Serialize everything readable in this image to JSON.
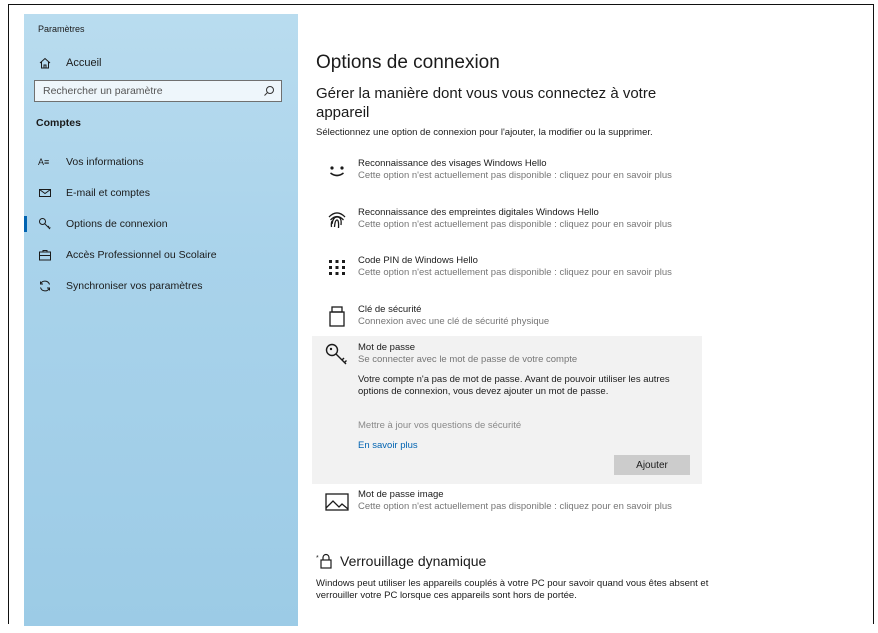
{
  "sidebar": {
    "app_title": "Paramètres",
    "home_label": "Accueil",
    "search_placeholder": "Rechercher un paramètre",
    "section_title": "Comptes",
    "items": [
      {
        "label": "Vos informations",
        "icon": "person-card-icon"
      },
      {
        "label": "E-mail et comptes",
        "icon": "mail-icon"
      },
      {
        "label": "Options de connexion",
        "icon": "key-icon",
        "active": true
      },
      {
        "label": "Accès Professionnel ou Scolaire",
        "icon": "briefcase-icon"
      },
      {
        "label": "Synchroniser vos paramètres",
        "icon": "sync-icon"
      }
    ]
  },
  "main": {
    "title": "Options de connexion",
    "subtitle": "Gérer la manière dont vous vous connectez à votre appareil",
    "intro": "Sélectionnez une option de connexion pour l'ajouter, la modifier ou la supprimer.",
    "options": [
      {
        "title": "Reconnaissance des visages Windows Hello",
        "desc": "Cette option n'est actuellement pas disponible : cliquez pour en savoir plus",
        "icon": "face-icon"
      },
      {
        "title": "Reconnaissance des empreintes digitales Windows Hello",
        "desc": "Cette option n'est actuellement pas disponible : cliquez pour en savoir plus",
        "icon": "fingerprint-icon"
      },
      {
        "title": "Code PIN de Windows Hello",
        "desc": "Cette option n'est actuellement pas disponible : cliquez pour en savoir plus",
        "icon": "pin-keypad-icon"
      },
      {
        "title": "Clé de sécurité",
        "desc": "Connexion avec une clé de sécurité physique",
        "icon": "security-key-icon"
      }
    ],
    "password": {
      "title": "Mot de passe",
      "desc": "Se connecter avec le mot de passe de votre compte",
      "body": "Votre compte n'a pas de mot de passe. Avant de pouvoir utiliser les autres options de connexion, vous devez ajouter un mot de passe.",
      "update_link": "Mettre à jour vos questions de sécurité",
      "learn_more": "En savoir plus",
      "add_button": "Ajouter",
      "icon": "key-icon"
    },
    "picture_password": {
      "title": "Mot de passe image",
      "desc": "Cette option n'est actuellement pas disponible : cliquez pour en savoir plus",
      "icon": "image-icon"
    },
    "dynamic_lock": {
      "title": "Verrouillage dynamique",
      "body": "Windows peut utiliser les appareils couplés à votre PC pour savoir quand vous êtes absent et verrouiller votre PC lorsque ces appareils sont hors de portée.",
      "icon": "dynamic-lock-icon"
    }
  },
  "colors": {
    "accent": "#0063b1",
    "sidebar_bg": "#a9d3eb",
    "expanded_bg": "#f2f2f2",
    "button_bg": "#cccccc"
  }
}
